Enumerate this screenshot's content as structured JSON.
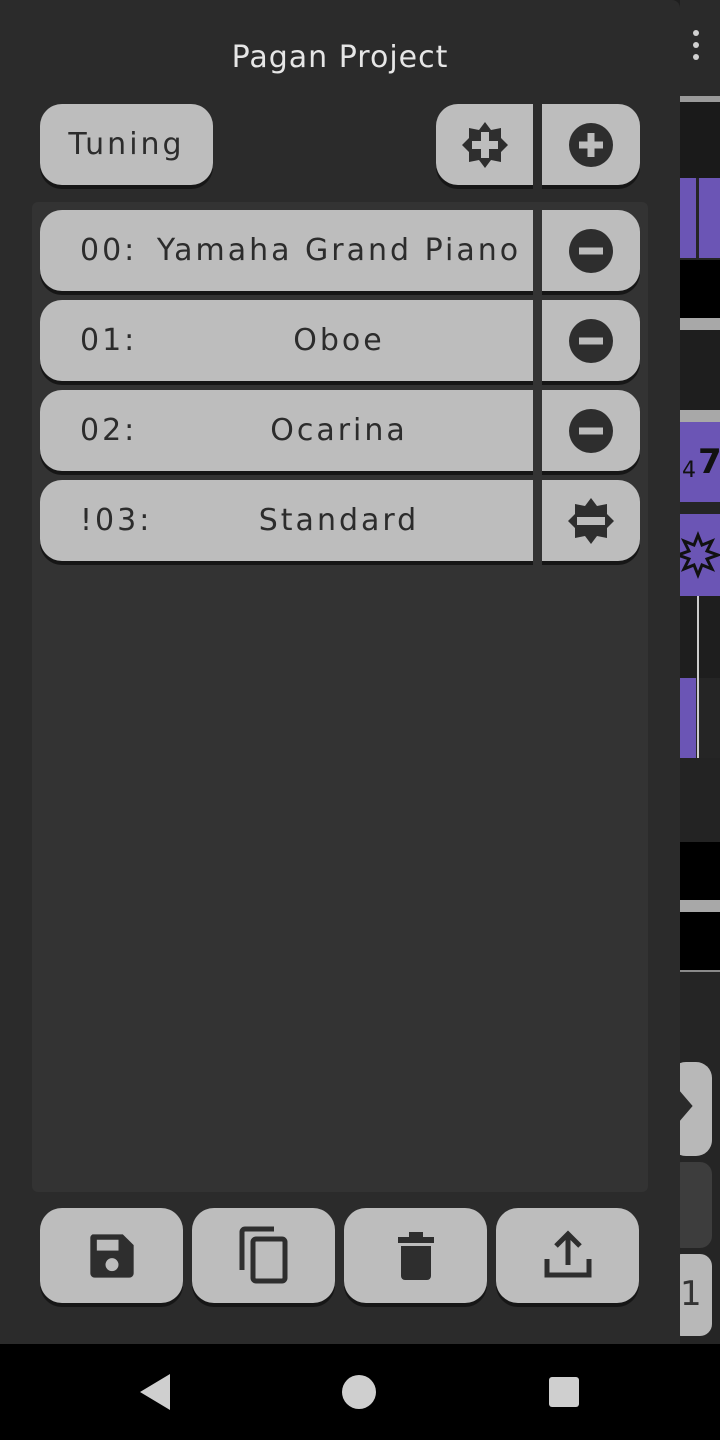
{
  "drawer": {
    "title": "Pagan Project",
    "tuning_label": "Tuning",
    "header_icons": [
      "add-percussion-icon",
      "add-channel-icon"
    ],
    "channels": [
      {
        "number": "00:",
        "name": "Yamaha Grand Piano",
        "action_icon": "remove-icon"
      },
      {
        "number": "01:",
        "name": "Oboe",
        "action_icon": "remove-icon"
      },
      {
        "number": "02:",
        "name": "Ocarina",
        "action_icon": "remove-icon"
      },
      {
        "number": "!03:",
        "name": "Standard",
        "action_icon": "remove-percussion-icon"
      }
    ],
    "footer_icons": [
      "save-icon",
      "copy-icon",
      "delete-icon",
      "export-icon"
    ]
  },
  "background": {
    "visible_text": [
      "4",
      "7",
      "1"
    ]
  },
  "colors": {
    "drawer_bg": "#2b2b2b",
    "button_bg": "#bdbdbd",
    "accent_purple": "#6b55b5"
  },
  "nav_icons": [
    "back-icon",
    "home-icon",
    "recents-icon"
  ]
}
